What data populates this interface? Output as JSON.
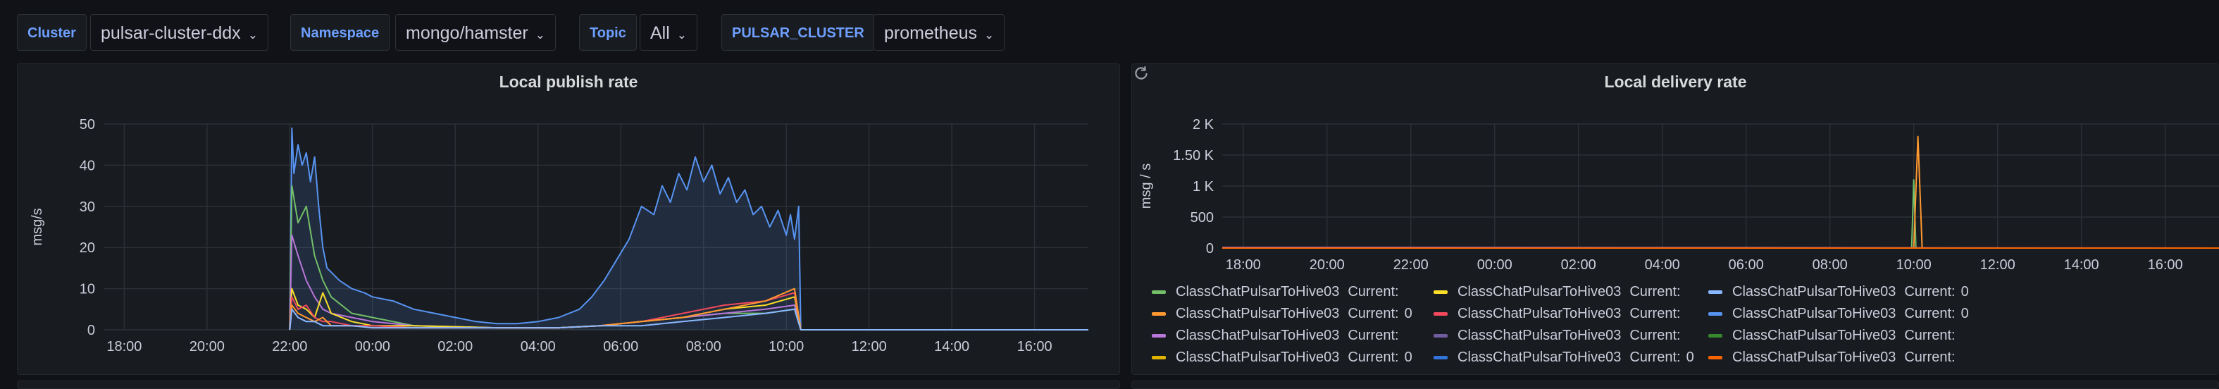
{
  "variables": [
    {
      "label": "Cluster",
      "value": "pulsar-cluster-ddx"
    },
    {
      "label": "Namespace",
      "value": "mongo/hamster"
    },
    {
      "label": "Topic",
      "value": "All"
    },
    {
      "label": "PULSAR_CLUSTER",
      "value": "prometheus"
    }
  ],
  "icons": {
    "dropdown": "chevron-down-icon",
    "refresh": "refresh-icon"
  },
  "colors": {
    "background": "#111217",
    "panel": "#181b1f",
    "accent_label": "#6e9fff"
  },
  "chart_data": [
    {
      "type": "line",
      "title": "Local publish rate",
      "ylabel": "msg/s",
      "xlabel": "",
      "ylim": [
        0,
        50
      ],
      "yticks": [
        0,
        10,
        20,
        30,
        40,
        50
      ],
      "ytick_labels": [
        "0",
        "10",
        "20",
        "30",
        "40",
        "50"
      ],
      "xlim": [
        17.5,
        41.3
      ],
      "xticks": [
        18,
        20,
        22,
        24,
        26,
        28,
        30,
        32,
        34,
        36,
        38,
        40
      ],
      "xtick_labels": [
        "18:00",
        "20:00",
        "22:00",
        "00:00",
        "02:00",
        "04:00",
        "06:00",
        "08:00",
        "10:00",
        "12:00",
        "14:00",
        "16:00"
      ],
      "grid": true,
      "legend": "none",
      "series": [
        {
          "color": "#5794f2",
          "fill": true,
          "x": [
            22.0,
            22.05,
            22.1,
            22.2,
            22.3,
            22.4,
            22.5,
            22.6,
            22.7,
            22.8,
            22.9,
            23.0,
            23.2,
            23.5,
            23.8,
            24.0,
            24.5,
            25.0,
            25.5,
            26.0,
            26.5,
            27.0,
            27.5,
            28.0,
            28.5,
            29.0,
            29.3,
            29.6,
            29.9,
            30.2,
            30.5,
            30.8,
            31.0,
            31.2,
            31.4,
            31.6,
            31.8,
            32.0,
            32.2,
            32.4,
            32.6,
            32.8,
            33.0,
            33.2,
            33.4,
            33.6,
            33.8,
            34.0,
            34.1,
            34.2,
            34.3,
            34.35,
            41.3
          ],
          "y": [
            0,
            49,
            38,
            45,
            40,
            43,
            36,
            42,
            30,
            20,
            15,
            14,
            12,
            10,
            9,
            8,
            7,
            5,
            4,
            3,
            2,
            1.5,
            1.5,
            2,
            3,
            5,
            8,
            12,
            17,
            22,
            30,
            28,
            35,
            31,
            38,
            34,
            42,
            36,
            40,
            33,
            37,
            31,
            34,
            28,
            30,
            25,
            29,
            23,
            28,
            22,
            30,
            0,
            0
          ]
        },
        {
          "color": "#73bf69",
          "fill": false,
          "x": [
            22.0,
            22.05,
            22.2,
            22.4,
            22.6,
            22.8,
            23.0,
            23.5,
            24.0,
            25.0,
            27.0,
            28.5,
            29.5,
            30.5,
            31.5,
            32.5,
            33.5,
            34.2,
            34.35,
            41.3
          ],
          "y": [
            0,
            35,
            26,
            30,
            18,
            12,
            8,
            4,
            3,
            1,
            0.5,
            0.5,
            1,
            2,
            3,
            4,
            4,
            5,
            0,
            0
          ]
        },
        {
          "color": "#b877d9",
          "fill": false,
          "x": [
            22.0,
            22.05,
            22.2,
            22.4,
            22.6,
            22.8,
            23.0,
            23.5,
            24.0,
            25.0,
            27.0,
            28.5,
            29.5,
            30.5,
            31.5,
            32.5,
            33.5,
            34.2,
            34.35,
            41.3
          ],
          "y": [
            0,
            23,
            18,
            12,
            8,
            5,
            4,
            3,
            2,
            1,
            0.5,
            0.5,
            1,
            2,
            3,
            4,
            5,
            6,
            0,
            0
          ]
        },
        {
          "color": "#fade2a",
          "fill": false,
          "x": [
            22.0,
            22.05,
            22.2,
            22.4,
            22.6,
            22.8,
            23.0,
            23.5,
            24.0,
            25.0,
            27.0,
            28.5,
            29.5,
            30.5,
            31.5,
            32.5,
            33.5,
            34.2,
            34.35,
            41.3
          ],
          "y": [
            0,
            10,
            6,
            5,
            3,
            9,
            4,
            2,
            1,
            1,
            0.5,
            0.5,
            1,
            2,
            3,
            5,
            6,
            8,
            0,
            0
          ]
        },
        {
          "color": "#f2495c",
          "fill": false,
          "x": [
            22.0,
            22.05,
            22.2,
            22.4,
            22.6,
            22.8,
            23.0,
            23.5,
            24.0,
            25.0,
            27.0,
            28.5,
            29.5,
            30.5,
            31.5,
            32.5,
            33.5,
            34.2,
            34.35,
            41.3
          ],
          "y": [
            0,
            8,
            5,
            6,
            3,
            2,
            2,
            1,
            1,
            0.5,
            0.5,
            0.5,
            1,
            2,
            4,
            6,
            7,
            9,
            0,
            0
          ]
        },
        {
          "color": "#ff9830",
          "fill": false,
          "x": [
            22.0,
            22.05,
            22.2,
            22.4,
            22.6,
            22.8,
            23.0,
            23.5,
            24.0,
            25.0,
            27.0,
            28.5,
            29.5,
            30.5,
            31.5,
            32.5,
            33.5,
            34.2,
            34.35,
            41.3
          ],
          "y": [
            0,
            6,
            4,
            3,
            2,
            3,
            1,
            1,
            0.5,
            0.5,
            0.5,
            0.5,
            1,
            2,
            3,
            5,
            7,
            10,
            0,
            0
          ]
        },
        {
          "color": "#8ab8ff",
          "fill": false,
          "x": [
            22.0,
            22.05,
            22.2,
            22.4,
            22.6,
            22.8,
            23.0,
            23.5,
            24.0,
            25.0,
            27.0,
            28.5,
            29.5,
            30.5,
            31.5,
            32.5,
            33.5,
            34.2,
            34.35,
            41.3
          ],
          "y": [
            0,
            5,
            3,
            2,
            2,
            1,
            1,
            1,
            0.5,
            0.5,
            0.5,
            0.5,
            1,
            1,
            2,
            3,
            4,
            5,
            0,
            0
          ]
        }
      ]
    },
    {
      "type": "line",
      "title": "Local delivery rate",
      "ylabel": "msg / s",
      "xlabel": "",
      "ylim": [
        0,
        2000
      ],
      "yticks": [
        0,
        500,
        1000,
        1500,
        2000
      ],
      "ytick_labels": [
        "0",
        "500",
        "1 K",
        "1.50 K",
        "2 K"
      ],
      "xlim": [
        17.5,
        41.3
      ],
      "xticks": [
        18,
        20,
        22,
        24,
        26,
        28,
        30,
        32,
        34,
        36,
        38,
        40
      ],
      "xtick_labels": [
        "18:00",
        "20:00",
        "22:00",
        "00:00",
        "02:00",
        "04:00",
        "06:00",
        "08:00",
        "10:00",
        "12:00",
        "14:00",
        "16:00"
      ],
      "grid": true,
      "legend": "bottom",
      "series": [
        {
          "name": "ClassChatPulsarToHive03",
          "current": "",
          "color": "#73bf69",
          "x": [
            17.5,
            33.95,
            34.0,
            34.05,
            41.3
          ],
          "y": [
            0,
            0,
            1100,
            0,
            0
          ]
        },
        {
          "name": "ClassChatPulsarToHive03",
          "current": "",
          "color": "#fade2a",
          "x": [
            17.5,
            41.3
          ],
          "y": [
            0,
            0
          ]
        },
        {
          "name": "ClassChatPulsarToHive03",
          "current": "0",
          "color": "#8ab8ff",
          "x": [
            17.5,
            41.3
          ],
          "y": [
            0,
            0
          ]
        },
        {
          "name": "ClassChatPulsarToHive03",
          "current": "0",
          "color": "#ff9830",
          "x": [
            17.5,
            34.0,
            34.1,
            34.2,
            41.3
          ],
          "y": [
            0,
            0,
            1800,
            0,
            0
          ]
        },
        {
          "name": "ClassChatPulsarToHive03",
          "current": "",
          "color": "#f2495c",
          "x": [
            17.5,
            41.3
          ],
          "y": [
            0,
            0
          ]
        },
        {
          "name": "ClassChatPulsarToHive03",
          "current": "0",
          "color": "#5794f2",
          "x": [
            17.5,
            41.3
          ],
          "y": [
            0,
            0
          ]
        },
        {
          "name": "ClassChatPulsarToHive03",
          "current": "",
          "color": "#b877d9",
          "x": [
            17.5,
            22.0,
            41.3
          ],
          "y": [
            10,
            10,
            0
          ]
        },
        {
          "name": "ClassChatPulsarToHive03",
          "current": "",
          "color": "#705da0",
          "x": [
            17.5,
            41.3
          ],
          "y": [
            0,
            0
          ]
        },
        {
          "name": "ClassChatPulsarToHive03",
          "current": "",
          "color": "#37872d",
          "x": [
            17.5,
            41.3
          ],
          "y": [
            0,
            0
          ]
        },
        {
          "name": "ClassChatPulsarToHive03",
          "current": "0",
          "color": "#e0b400",
          "x": [
            17.5,
            41.3
          ],
          "y": [
            0,
            0
          ]
        },
        {
          "name": "ClassChatPulsarToHive03",
          "current": "0",
          "color": "#3274d9",
          "x": [
            17.5,
            41.3
          ],
          "y": [
            0,
            0
          ]
        },
        {
          "name": "ClassChatPulsarToHive03",
          "current": "",
          "color": "#fa6400",
          "x": [
            17.5,
            41.3
          ],
          "y": [
            0,
            0
          ]
        }
      ]
    }
  ],
  "legend_current_label": "Current:"
}
